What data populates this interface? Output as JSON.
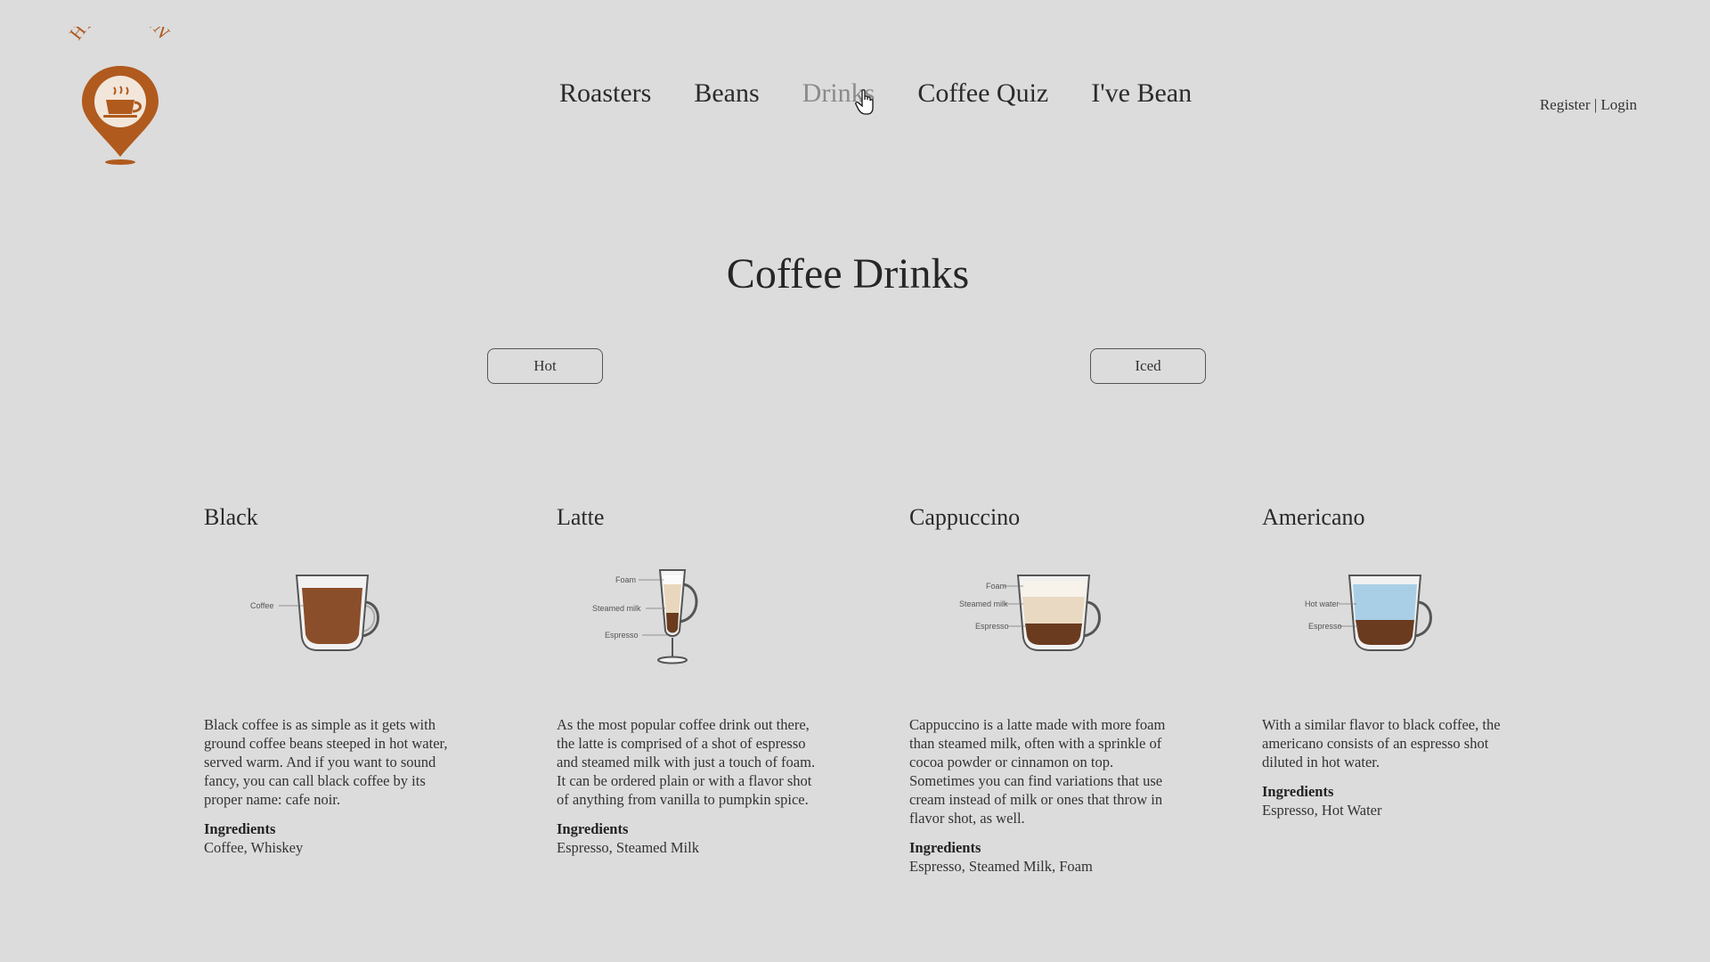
{
  "brand": {
    "name": "HASBEAN",
    "color": "#b05a1e"
  },
  "nav": {
    "items": [
      {
        "label": "Roasters",
        "active": false
      },
      {
        "label": "Beans",
        "active": false
      },
      {
        "label": "Drinks",
        "active": true
      },
      {
        "label": "Coffee Quiz",
        "active": false
      },
      {
        "label": "I've Bean",
        "active": false
      }
    ]
  },
  "auth": {
    "register": "Register",
    "separator": "|",
    "login": "Login"
  },
  "page": {
    "title": "Coffee Drinks"
  },
  "filters": {
    "hot": "Hot",
    "iced": "Iced"
  },
  "drinks": [
    {
      "name": "Black",
      "cup_labels": [
        "Coffee"
      ],
      "description": "Black coffee is as simple as it gets with ground coffee beans steeped in hot water, served warm. And if you want to sound fancy, you can call black coffee by its proper name: cafe noir.",
      "ingredients_title": "Ingredients",
      "ingredients": "Coffee, Whiskey"
    },
    {
      "name": "Latte",
      "cup_labels": [
        "Foam",
        "Steamed milk",
        "Espresso"
      ],
      "description": "As the most popular coffee drink out there, the latte is comprised of a shot of espresso and steamed milk with just a touch of foam. It can be ordered plain or with a flavor shot of anything from vanilla to pumpkin spice.",
      "ingredients_title": "Ingredients",
      "ingredients": "Espresso, Steamed Milk"
    },
    {
      "name": "Cappuccino",
      "cup_labels": [
        "Foam",
        "Steamed milk",
        "Espresso"
      ],
      "description": "Cappuccino is a latte made with more foam than steamed milk, often with a sprinkle of cocoa powder or cinnamon on top. Sometimes you can find variations that use cream instead of milk or ones that throw in flavor shot, as well.",
      "ingredients_title": "Ingredients",
      "ingredients": "Espresso, Steamed Milk, Foam"
    },
    {
      "name": "Americano",
      "cup_labels": [
        "Hot water",
        "Espresso"
      ],
      "description": "With a similar flavor to black coffee, the americano consists of an espresso shot diluted in hot water.",
      "ingredients_title": "Ingredients",
      "ingredients": "Espresso, Hot Water"
    }
  ]
}
